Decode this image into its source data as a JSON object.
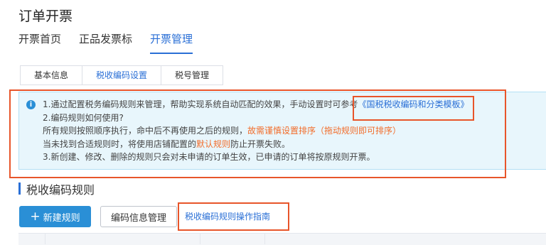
{
  "page": {
    "title": "订单开票"
  },
  "main_tabs": [
    {
      "label": "开票首页",
      "active": false
    },
    {
      "label": "正品发票标",
      "active": false
    },
    {
      "label": "开票管理",
      "active": true
    }
  ],
  "sub_tabs": [
    {
      "label": "基本信息",
      "active": false
    },
    {
      "label": "税收编码设置",
      "active": true
    },
    {
      "label": "税号管理",
      "active": false
    }
  ],
  "info": {
    "icon": "info-icon",
    "line1_text": "1.通过配置税务编码规则来管理，帮助实现系统自动匹配的效果，手动设置时可参考",
    "line1_link": "《国税税收编码和分类模板》",
    "line2": "2.编码规则如何使用?",
    "line3_text": "所有规则按照顺序执行，命中后不再使用之后的规则，",
    "line3_warn": "故需谨慎设置排序（拖动规则即可排序）",
    "line4_pre": "当未找到合适规则时，将使用店铺配置的",
    "line4_warn": "默认规则",
    "line4_post": "防止开票失败。",
    "line5": "3.新创建、修改、删除的规则只会对未申请的订单生效，已申请的订单将按原规则开票。"
  },
  "section": {
    "title": "税收编码规则"
  },
  "actions": {
    "new_rule_icon": "plus-icon",
    "new_rule": "新建规则",
    "code_info": "编码信息管理",
    "guide": "税收编码规则操作指南"
  },
  "colors": {
    "accent": "#2a6fd6",
    "warning": "#f26d2b",
    "highlight": "#e8552a"
  }
}
